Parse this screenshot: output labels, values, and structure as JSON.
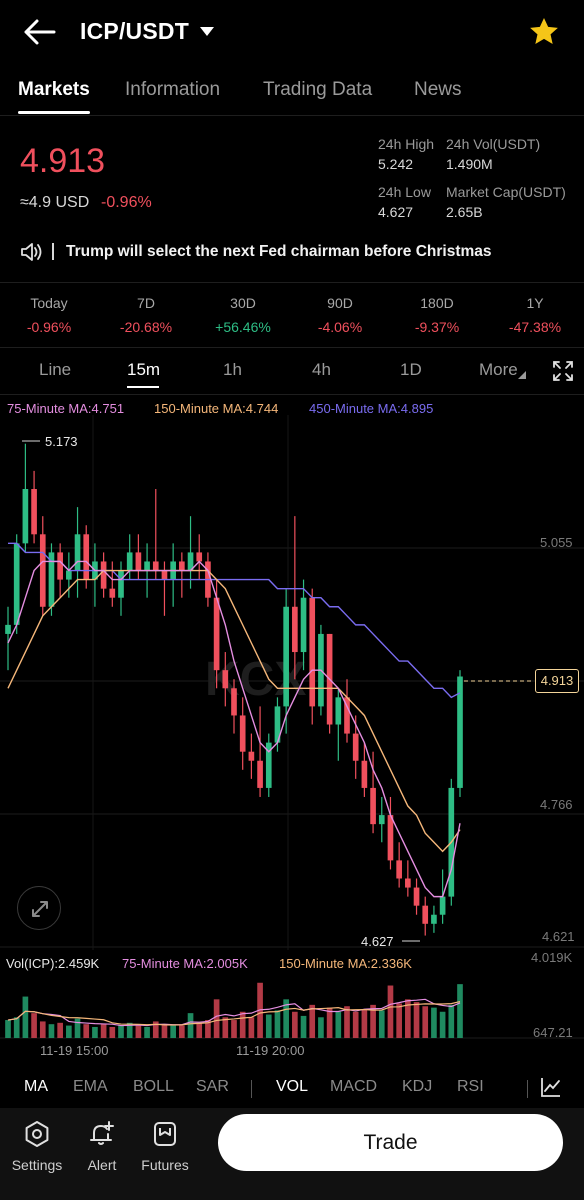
{
  "header": {
    "pair": "ICP/USDT"
  },
  "tabs": [
    {
      "label": "Markets",
      "active": true
    },
    {
      "label": "Information",
      "active": false
    },
    {
      "label": "Trading Data",
      "active": false
    },
    {
      "label": "News",
      "active": false
    }
  ],
  "price": {
    "last": "4.913",
    "usd_approx": "≈4.9 USD",
    "change": "-0.96%"
  },
  "stats": {
    "high_label": "24h High",
    "high_value": "5.242",
    "vol_label": "24h Vol(USDT)",
    "vol_value": "1.490M",
    "low_label": "24h Low",
    "low_value": "4.627",
    "cap_label": "Market Cap(USDT)",
    "cap_value": "2.65B"
  },
  "ticker": {
    "text": "Trump will select the next Fed chairman before Christmas"
  },
  "periods": [
    {
      "label": "Today",
      "value": "-0.96%",
      "dir": "down"
    },
    {
      "label": "7D",
      "value": "-20.68%",
      "dir": "down"
    },
    {
      "label": "30D",
      "value": "+56.46%",
      "dir": "up"
    },
    {
      "label": "90D",
      "value": "-4.06%",
      "dir": "down"
    },
    {
      "label": "180D",
      "value": "-9.37%",
      "dir": "down"
    },
    {
      "label": "1Y",
      "value": "-47.38%",
      "dir": "down"
    }
  ],
  "intervals": [
    {
      "label": "Line",
      "active": false
    },
    {
      "label": "15m",
      "active": true
    },
    {
      "label": "1h",
      "active": false
    },
    {
      "label": "4h",
      "active": false
    },
    {
      "label": "1D",
      "active": false
    },
    {
      "label": "More",
      "active": false
    }
  ],
  "ma_legend": {
    "ma75": "75-Minute MA:4.751",
    "ma150": "150-Minute MA:4.744",
    "ma450": "450-Minute MA:4.895"
  },
  "chart_labels": {
    "high_marker": "5.173",
    "low_marker": "4.627",
    "axis_top": "5.055",
    "axis_mid": "4.766",
    "axis_bottom": "4.621",
    "current_tag": "4.913",
    "watermark": "KCX"
  },
  "volume_legend": {
    "vol": "Vol(ICP):2.459K",
    "ma75": "75-Minute MA:2.005K",
    "ma150": "150-Minute MA:2.336K",
    "axis_top": "4.019K",
    "axis_bottom": "647.21"
  },
  "time_axis": [
    "11-19 15:00",
    "11-19 20:00"
  ],
  "indicators": {
    "main": [
      "MA",
      "EMA",
      "BOLL",
      "SAR"
    ],
    "sub": [
      "VOL",
      "MACD",
      "KDJ",
      "RSI"
    ]
  },
  "bottom_bar": {
    "settings": "Settings",
    "alert": "Alert",
    "futures": "Futures",
    "trade": "Trade"
  },
  "colors": {
    "up": "#2ebd85",
    "down": "#f0505d",
    "ma75": "#e48ee0",
    "ma150": "#f5b77a",
    "ma450": "#7a6cf0",
    "accent_star": "#f5c518"
  },
  "chart_data": {
    "type": "candlestick",
    "interval": "15m",
    "ylim": [
      4.621,
      5.173
    ],
    "x_ticks": [
      "11-19 15:00",
      "11-19 20:00"
    ],
    "candles": [
      {
        "o": 4.96,
        "h": 4.99,
        "l": 4.92,
        "c": 4.97
      },
      {
        "o": 4.97,
        "h": 5.07,
        "l": 4.96,
        "c": 5.06
      },
      {
        "o": 5.06,
        "h": 5.17,
        "l": 5.05,
        "c": 5.12
      },
      {
        "o": 5.12,
        "h": 5.14,
        "l": 5.06,
        "c": 5.07
      },
      {
        "o": 5.07,
        "h": 5.09,
        "l": 4.98,
        "c": 4.99
      },
      {
        "o": 4.99,
        "h": 5.06,
        "l": 4.98,
        "c": 5.05
      },
      {
        "o": 5.05,
        "h": 5.06,
        "l": 5.0,
        "c": 5.02
      },
      {
        "o": 5.02,
        "h": 5.05,
        "l": 5.0,
        "c": 5.03
      },
      {
        "o": 5.03,
        "h": 5.1,
        "l": 5.0,
        "c": 5.07
      },
      {
        "o": 5.07,
        "h": 5.08,
        "l": 5.01,
        "c": 5.02
      },
      {
        "o": 5.02,
        "h": 5.06,
        "l": 4.99,
        "c": 5.04
      },
      {
        "o": 5.04,
        "h": 5.05,
        "l": 5.0,
        "c": 5.01
      },
      {
        "o": 5.01,
        "h": 5.04,
        "l": 4.99,
        "c": 5.0
      },
      {
        "o": 5.0,
        "h": 5.04,
        "l": 4.98,
        "c": 5.03
      },
      {
        "o": 5.03,
        "h": 5.07,
        "l": 5.02,
        "c": 5.05
      },
      {
        "o": 5.05,
        "h": 5.07,
        "l": 5.02,
        "c": 5.03
      },
      {
        "o": 5.03,
        "h": 5.06,
        "l": 5.0,
        "c": 5.04
      },
      {
        "o": 5.04,
        "h": 5.12,
        "l": 5.02,
        "c": 5.03
      },
      {
        "o": 5.03,
        "h": 5.04,
        "l": 4.98,
        "c": 5.02
      },
      {
        "o": 5.02,
        "h": 5.06,
        "l": 4.99,
        "c": 5.04
      },
      {
        "o": 5.04,
        "h": 5.05,
        "l": 5.0,
        "c": 5.03
      },
      {
        "o": 5.03,
        "h": 5.09,
        "l": 5.01,
        "c": 5.05
      },
      {
        "o": 5.05,
        "h": 5.07,
        "l": 5.02,
        "c": 5.04
      },
      {
        "o": 5.04,
        "h": 5.05,
        "l": 4.99,
        "c": 5.0
      },
      {
        "o": 5.0,
        "h": 5.02,
        "l": 4.9,
        "c": 4.92
      },
      {
        "o": 4.92,
        "h": 4.94,
        "l": 4.88,
        "c": 4.9
      },
      {
        "o": 4.9,
        "h": 4.91,
        "l": 4.85,
        "c": 4.87
      },
      {
        "o": 4.87,
        "h": 4.89,
        "l": 4.81,
        "c": 4.83
      },
      {
        "o": 4.83,
        "h": 4.85,
        "l": 4.8,
        "c": 4.82
      },
      {
        "o": 4.82,
        "h": 4.88,
        "l": 4.78,
        "c": 4.79
      },
      {
        "o": 4.79,
        "h": 4.85,
        "l": 4.78,
        "c": 4.84
      },
      {
        "o": 4.84,
        "h": 4.89,
        "l": 4.83,
        "c": 4.88
      },
      {
        "o": 4.88,
        "h": 5.01,
        "l": 4.85,
        "c": 4.99
      },
      {
        "o": 4.99,
        "h": 5.09,
        "l": 4.91,
        "c": 4.94
      },
      {
        "o": 4.94,
        "h": 5.02,
        "l": 4.92,
        "c": 5.0
      },
      {
        "o": 5.0,
        "h": 5.01,
        "l": 4.86,
        "c": 4.88
      },
      {
        "o": 4.88,
        "h": 4.97,
        "l": 4.87,
        "c": 4.96
      },
      {
        "o": 4.96,
        "h": 4.96,
        "l": 4.85,
        "c": 4.86
      },
      {
        "o": 4.86,
        "h": 4.9,
        "l": 4.82,
        "c": 4.89
      },
      {
        "o": 4.89,
        "h": 4.91,
        "l": 4.84,
        "c": 4.85
      },
      {
        "o": 4.85,
        "h": 4.87,
        "l": 4.8,
        "c": 4.82
      },
      {
        "o": 4.82,
        "h": 4.84,
        "l": 4.78,
        "c": 4.79
      },
      {
        "o": 4.79,
        "h": 4.83,
        "l": 4.74,
        "c": 4.75
      },
      {
        "o": 4.75,
        "h": 4.78,
        "l": 4.73,
        "c": 4.76
      },
      {
        "o": 4.76,
        "h": 4.78,
        "l": 4.7,
        "c": 4.71
      },
      {
        "o": 4.71,
        "h": 4.73,
        "l": 4.68,
        "c": 4.69
      },
      {
        "o": 4.69,
        "h": 4.71,
        "l": 4.67,
        "c": 4.68
      },
      {
        "o": 4.68,
        "h": 4.69,
        "l": 4.65,
        "c": 4.66
      },
      {
        "o": 4.66,
        "h": 4.67,
        "l": 4.627,
        "c": 4.64
      },
      {
        "o": 4.64,
        "h": 4.66,
        "l": 4.63,
        "c": 4.65
      },
      {
        "o": 4.65,
        "h": 4.7,
        "l": 4.64,
        "c": 4.67
      },
      {
        "o": 4.67,
        "h": 4.8,
        "l": 4.66,
        "c": 4.79
      },
      {
        "o": 4.79,
        "h": 4.92,
        "l": 4.78,
        "c": 4.913
      }
    ],
    "volume": [
      1.3,
      1.5,
      3.0,
      1.8,
      1.2,
      1.0,
      1.1,
      0.9,
      1.4,
      1.0,
      0.8,
      1.0,
      0.8,
      0.9,
      1.1,
      0.9,
      0.8,
      1.2,
      1.0,
      0.9,
      0.9,
      1.8,
      1.1,
      1.3,
      2.8,
      1.5,
      1.3,
      1.9,
      1.5,
      4.0,
      1.7,
      2.0,
      2.8,
      1.9,
      1.6,
      2.4,
      1.5,
      2.2,
      1.9,
      2.3,
      1.9,
      2.1,
      2.4,
      2.0,
      3.8,
      2.5,
      2.8,
      2.6,
      2.3,
      2.2,
      1.9,
      2.4,
      3.9
    ],
    "ma75": [
      4.95,
      4.97,
      5.0,
      5.03,
      5.04,
      5.04,
      5.04,
      5.03,
      5.04,
      5.04,
      5.03,
      5.03,
      5.02,
      5.02,
      5.03,
      5.03,
      5.03,
      5.03,
      5.03,
      5.03,
      5.03,
      5.03,
      5.04,
      5.03,
      5.0,
      4.97,
      4.93,
      4.9,
      4.87,
      4.84,
      4.83,
      4.84,
      4.87,
      4.89,
      4.91,
      4.92,
      4.92,
      4.91,
      4.9,
      4.88,
      4.86,
      4.84,
      4.81,
      4.79,
      4.76,
      4.74,
      4.72,
      4.7,
      4.68,
      4.67,
      4.67,
      4.7,
      4.751
    ],
    "ma150": [
      4.9,
      4.92,
      4.94,
      4.96,
      4.98,
      4.99,
      5.0,
      5.01,
      5.02,
      5.02,
      5.02,
      5.03,
      5.03,
      5.03,
      5.03,
      5.03,
      5.03,
      5.03,
      5.03,
      5.03,
      5.03,
      5.03,
      5.03,
      5.03,
      5.02,
      5.01,
      4.99,
      4.97,
      4.95,
      4.93,
      4.91,
      4.9,
      4.9,
      4.9,
      4.9,
      4.9,
      4.9,
      4.9,
      4.9,
      4.89,
      4.88,
      4.87,
      4.85,
      4.83,
      4.81,
      4.79,
      4.77,
      4.76,
      4.74,
      4.73,
      4.72,
      4.73,
      4.744
    ],
    "ma450": [
      5.06,
      5.06,
      5.05,
      5.05,
      5.05,
      5.04,
      5.04,
      5.03,
      5.03,
      5.03,
      5.03,
      5.03,
      5.03,
      5.02,
      5.02,
      5.02,
      5.02,
      5.02,
      5.02,
      5.02,
      5.02,
      5.02,
      5.02,
      5.02,
      5.02,
      5.02,
      5.02,
      5.02,
      5.02,
      5.02,
      5.02,
      5.01,
      5.01,
      5.01,
      5.01,
      5.0,
      5.0,
      4.99,
      4.99,
      4.98,
      4.97,
      4.97,
      4.96,
      4.95,
      4.94,
      4.93,
      4.93,
      4.92,
      4.91,
      4.9,
      4.9,
      4.89,
      4.895
    ]
  }
}
